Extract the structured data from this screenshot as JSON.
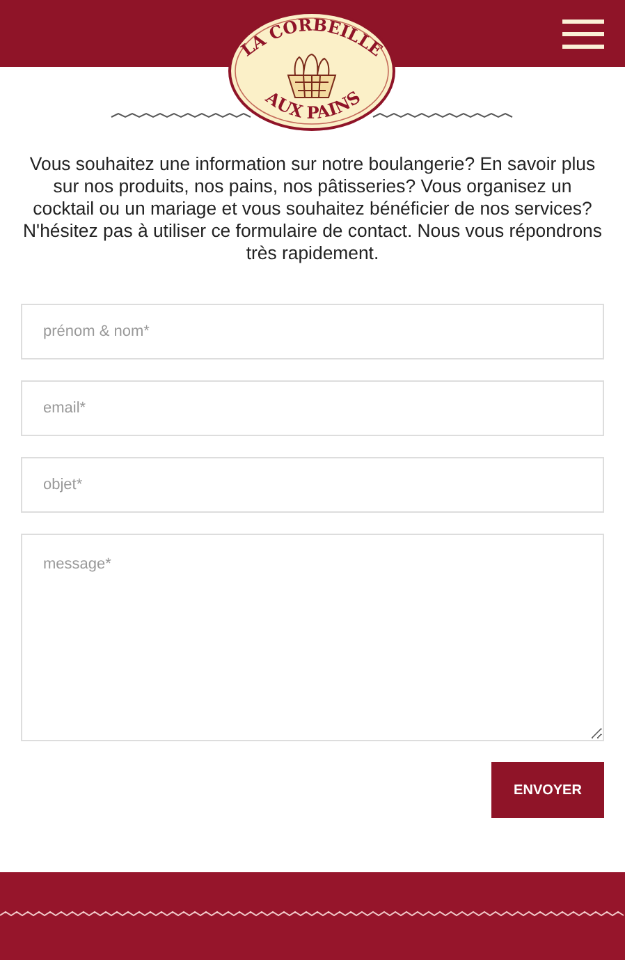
{
  "header": {
    "logo": {
      "top_text": "LA CORBEILLE",
      "bottom_text": "AUX PAINS"
    }
  },
  "intro": "Vous souhaitez une information sur notre boulangerie? En savoir plus sur nos produits, nos pains, nos pâtisseries? Vous organisez un cocktail ou un mariage et vous souhaitez bénéficier de nos services? N'hésitez pas à utiliser ce formulaire de contact. Nous vous répondrons très rapidement.",
  "form": {
    "fields": [
      {
        "kind": "input",
        "placeholder": "prénom & nom*"
      },
      {
        "kind": "input",
        "placeholder": "email*"
      },
      {
        "kind": "input",
        "placeholder": "objet*"
      },
      {
        "kind": "textarea",
        "placeholder": "message*"
      }
    ],
    "submit": "ENVOYER"
  }
}
